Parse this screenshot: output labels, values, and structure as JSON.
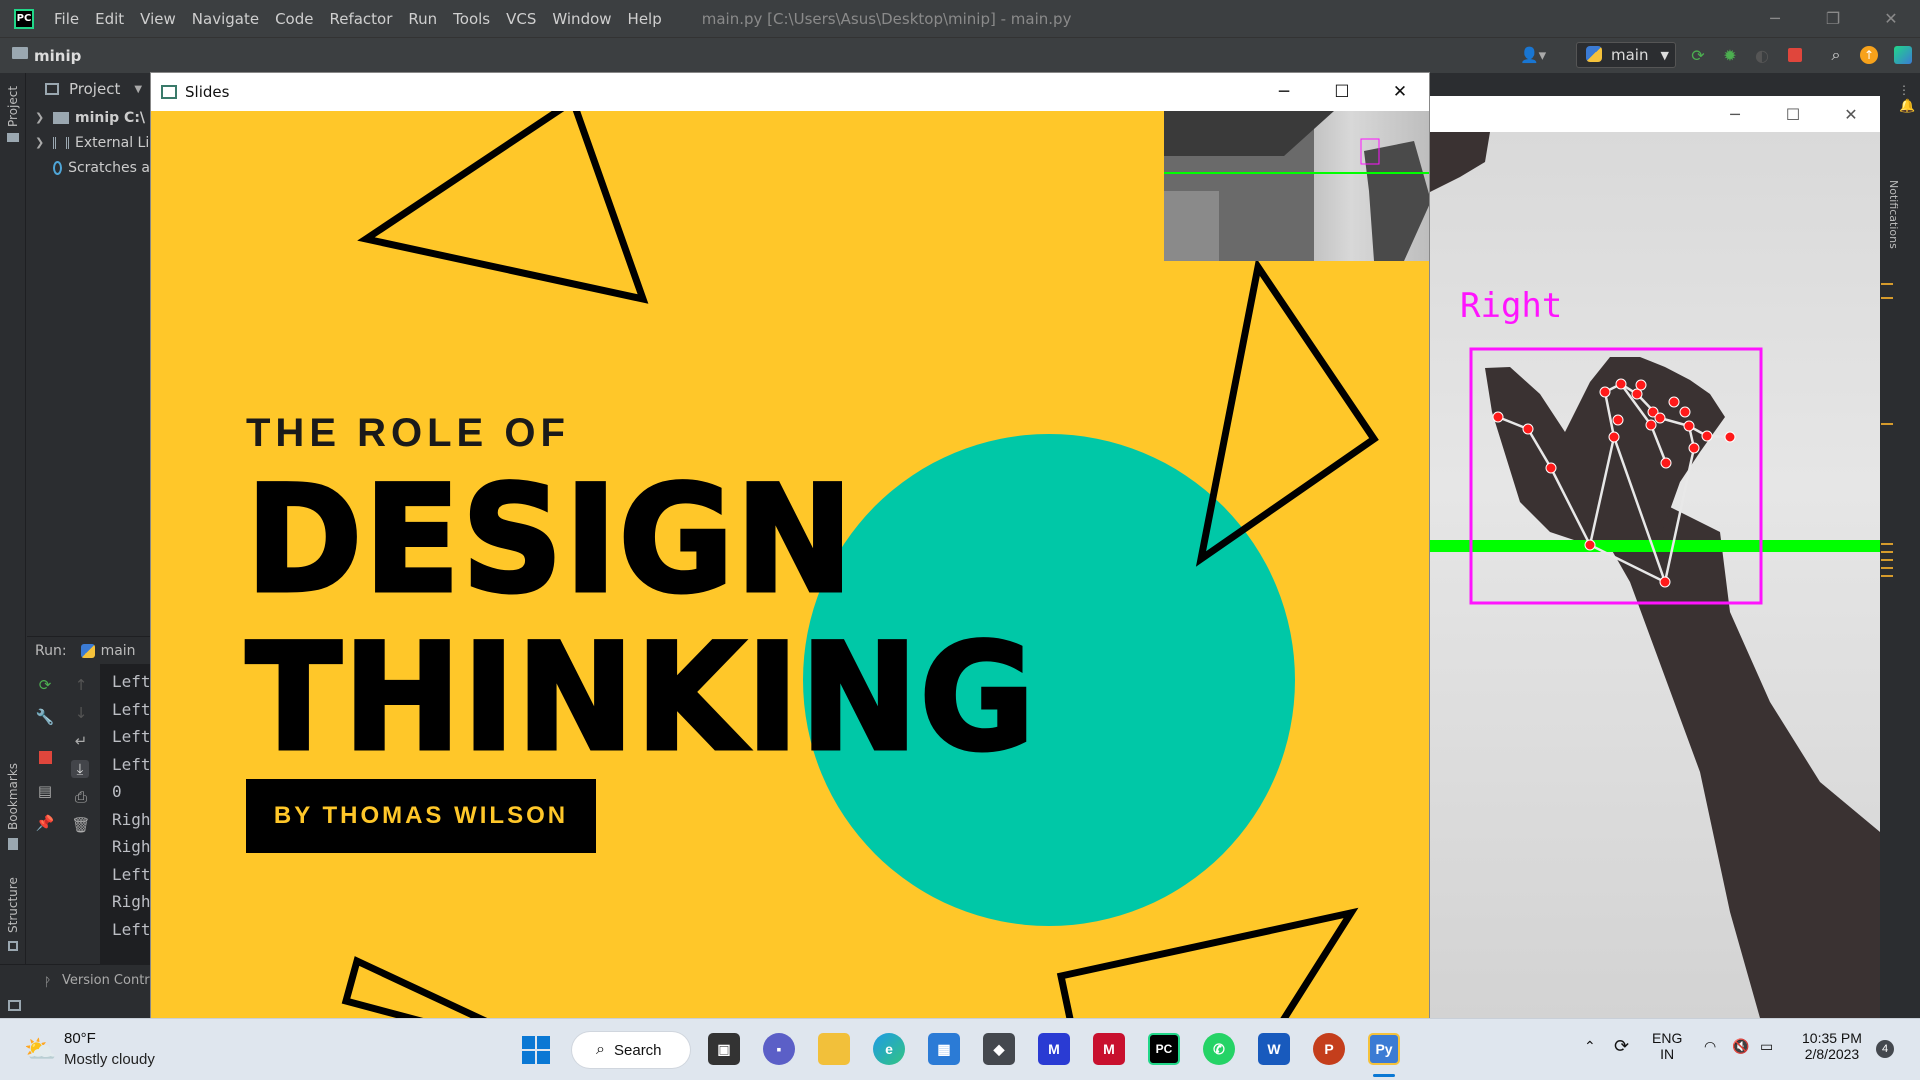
{
  "ide": {
    "menu": [
      "File",
      "Edit",
      "View",
      "Navigate",
      "Code",
      "Refactor",
      "Run",
      "Tools",
      "VCS",
      "Window",
      "Help"
    ],
    "title": "main.py [C:\\Users\\Asus\\Desktop\\minip] - main.py",
    "project_name": "minip",
    "run_config": "main",
    "project_panel": {
      "header": "Project",
      "tree": [
        "minip C:\\",
        "External Li",
        "Scratches a"
      ]
    },
    "left_strip": {
      "project": "Project",
      "bookmarks": "Bookmarks",
      "structure": "Structure"
    },
    "right_strip": {
      "notifications": "Notifications"
    },
    "run_panel": {
      "label": "Run:",
      "tab": "main",
      "console": [
        "Left",
        "Left",
        "Left",
        "Left",
        "0",
        "Righ",
        "Righ",
        "Left",
        "Righ",
        "Left"
      ]
    },
    "version_control": "Version Contro"
  },
  "slides_window": {
    "title": "Slides",
    "slide": {
      "subtitle": "THE ROLE OF",
      "title_line1": "DESIGN",
      "title_line2": "THINKING",
      "author": "BY THOMAS WILSON"
    }
  },
  "camera_window": {
    "hand_label": "Right"
  },
  "taskbar": {
    "weather_temp": "80°F",
    "weather_desc": "Mostly cloudy",
    "search": "Search",
    "lang_top": "ENG",
    "lang_bottom": "IN",
    "time": "10:35 PM",
    "date": "2/8/2023",
    "notification_count": "4"
  },
  "colors": {
    "slide_yellow": "#ffc729",
    "slide_teal": "#00c8a7",
    "hand_box": "#ff14ff",
    "scan_line": "#00ff00"
  }
}
